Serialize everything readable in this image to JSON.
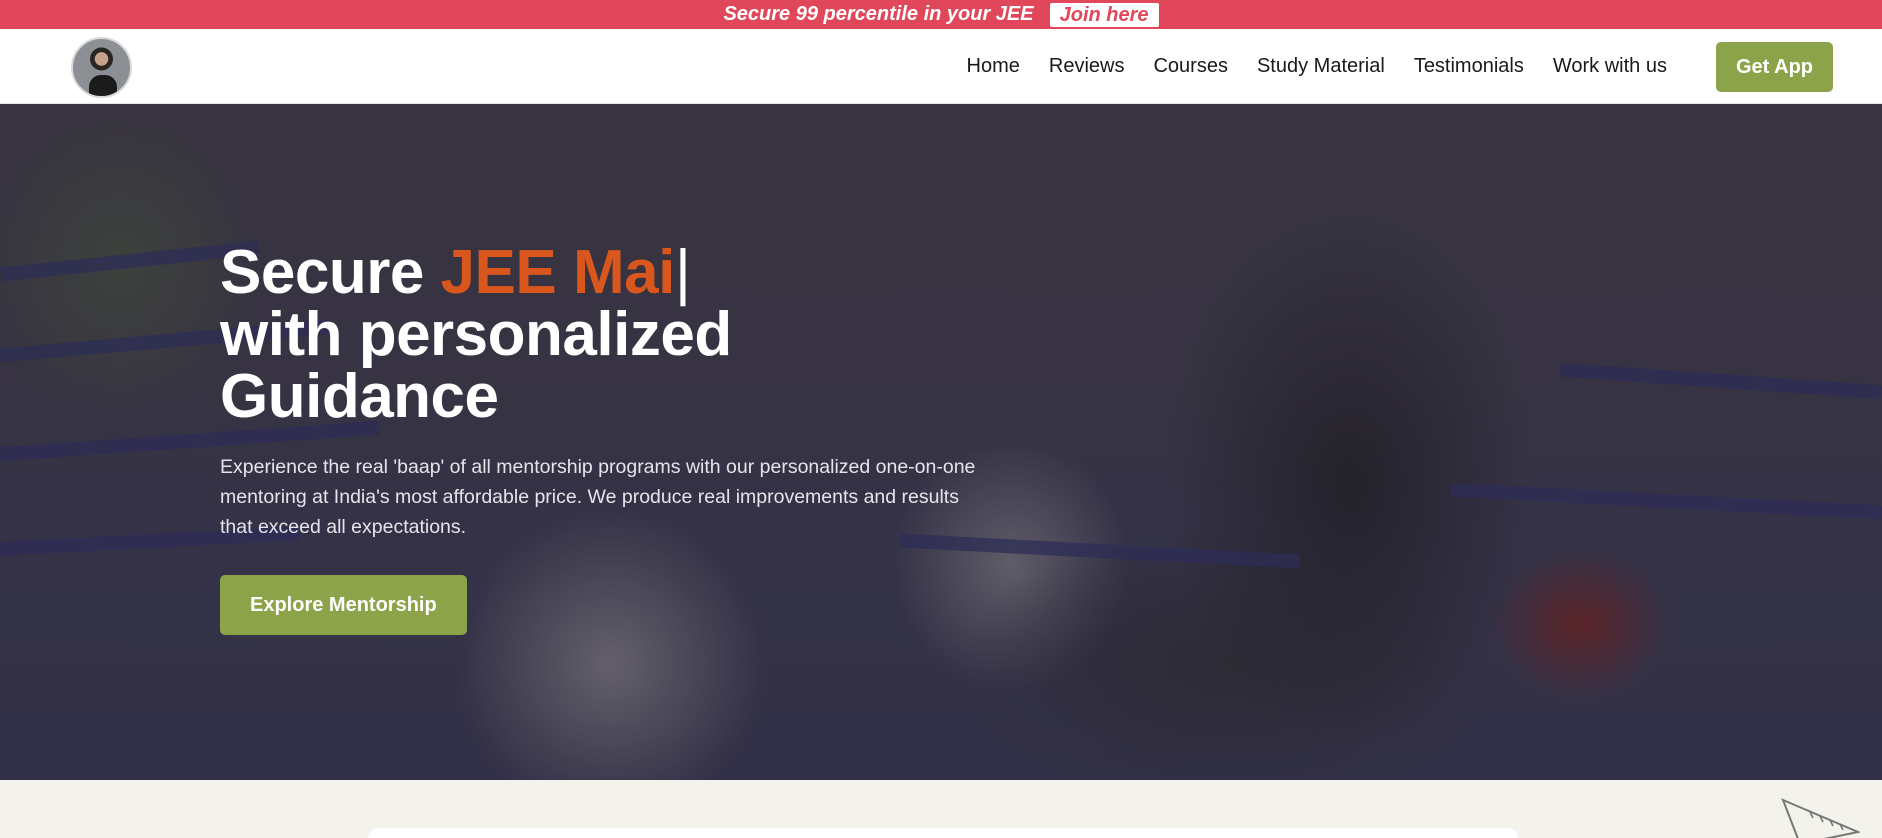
{
  "announcement": {
    "text": "Secure 99 percentile in your JEE",
    "button_label": "Join here"
  },
  "header": {
    "avatar_alt": "profile",
    "nav": [
      {
        "label": "Home"
      },
      {
        "label": "Reviews"
      },
      {
        "label": "Courses"
      },
      {
        "label": "Study Material"
      },
      {
        "label": "Testimonials"
      },
      {
        "label": "Work with us"
      }
    ],
    "cta_label": "Get App"
  },
  "hero": {
    "headline_prefix": "Secure ",
    "headline_accent": "JEE Mai",
    "headline_cursor": "|",
    "headline_line2": "with personalized Guidance",
    "subtext": "Experience the real 'baap' of all mentorship programs with our personalized one-on-one mentoring at India's most affordable price. We produce real improvements and results that exceed all expectations.",
    "cta_label": "Explore Mentorship"
  },
  "colors": {
    "announcement_bg": "#e0475a",
    "accent_green": "#8ca34a",
    "headline_accent": "#d9571c",
    "below_bg": "#f3f3ec"
  },
  "icons": {
    "decor": "ruler-triangle-icon"
  }
}
